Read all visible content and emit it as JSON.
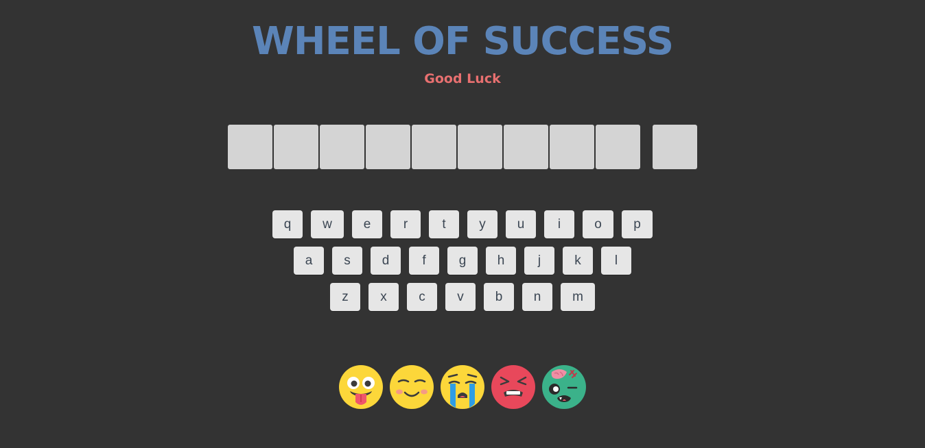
{
  "header": {
    "title": "WHEEL OF SUCCESS",
    "subtitle": "Good Luck"
  },
  "phrase": {
    "word_lengths": [
      9,
      1
    ]
  },
  "keyboard": {
    "rows": [
      [
        "q",
        "w",
        "e",
        "r",
        "t",
        "y",
        "u",
        "i",
        "o",
        "p"
      ],
      [
        "a",
        "s",
        "d",
        "f",
        "g",
        "h",
        "j",
        "k",
        "l"
      ],
      [
        "z",
        "x",
        "c",
        "v",
        "b",
        "n",
        "m"
      ]
    ]
  },
  "lives": {
    "icons": [
      "tongue-out-face-icon",
      "smiling-face-icon",
      "crying-face-icon",
      "angry-face-icon",
      "zombie-face-icon"
    ]
  },
  "colors": {
    "background": "#333333",
    "title": "#5b84b8",
    "subtitle": "#e87070",
    "tile": "#d4d4d4",
    "key": "#e6e6e6",
    "key_text": "#3b4653"
  }
}
